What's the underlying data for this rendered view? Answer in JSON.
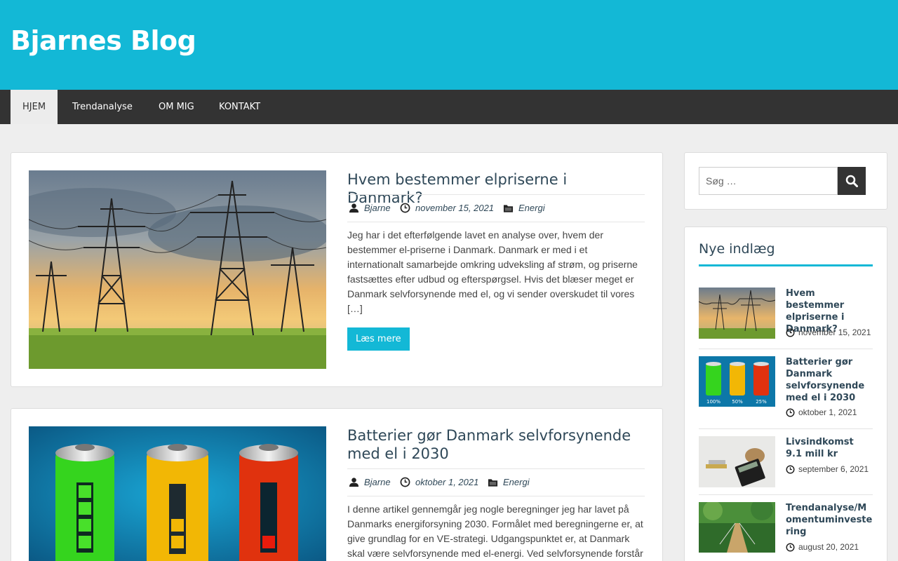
{
  "site": {
    "title": "Bjarnes Blog"
  },
  "nav": {
    "items": [
      {
        "label": "HJEM"
      },
      {
        "label": "Trendanalyse"
      },
      {
        "label": "OM MIG"
      },
      {
        "label": "KONTAKT"
      }
    ]
  },
  "posts": [
    {
      "title": "Hvem bestemmer elpriserne i Danmark?",
      "author": "Bjarne",
      "date": "november 15, 2021",
      "category": "Energi",
      "excerpt": "Jeg har i det efterfølgende lavet en analyse over, hvem der bestemmer el-priserne i Danmark. Danmark er med i et internationalt samarbejde omkring udveksling af strøm, og priserne fastsættes efter udbud og efterspørgsel. Hvis det blæser meget er Danmark selvforsynende med el, og vi sender overskudet til vores […]",
      "read_more": "Læs mere"
    },
    {
      "title": "Batterier gør Danmark selvforsynende med el i 2030",
      "author": "Bjarne",
      "date": "oktober 1, 2021",
      "category": "Energi",
      "excerpt": "I denne artikel gennemgår jeg nogle beregninger jeg har lavet på Danmarks energiforsyning 2030. Formålet med beregningerne er, at give grundlag for en VE-strategi. Udgangspunktet er, at Danmark skal være selvforsynende med el-energi. Ved selvforsynende forstår"
    }
  ],
  "battery_labels": [
    "100%",
    "50%",
    "25%"
  ],
  "sidebar": {
    "search_placeholder": "Søg …",
    "recent_title": "Nye indlæg",
    "recent": [
      {
        "title": "Hvem bestemmer elpriserne i Danmark?",
        "date": "november 15, 2021"
      },
      {
        "title": "Batterier gør Danmark selvforsynende med el i 2030",
        "date": "oktober 1, 2021"
      },
      {
        "title": "Livsindkomst 9.1 mill kr",
        "date": "september 6, 2021"
      },
      {
        "title": "Trendanalyse/Momentuminvestering",
        "date": "august 20, 2021"
      }
    ]
  },
  "colors": {
    "accent": "#13b8d6",
    "nav_bg": "#333333",
    "title_text": "#2f4858"
  }
}
